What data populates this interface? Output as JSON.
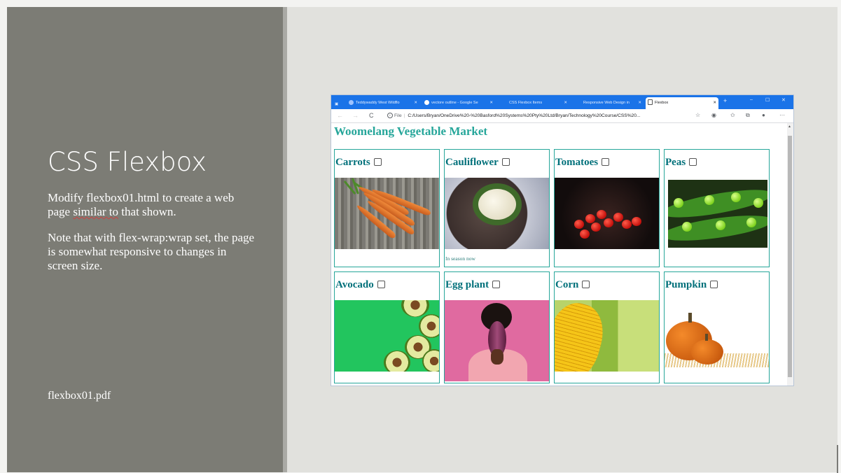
{
  "slide": {
    "title": "CSS Flexbox",
    "paragraph1_before": "Modify flexbox01.html to create a web page ",
    "paragraph1_squiggle": "similar to",
    "paragraph1_after": " that shown.",
    "paragraph2": "Note that with flex-wrap:wrap set, the page is somewhat responsive to changes in screen size.",
    "footer_file": "flexbox01.pdf"
  },
  "browser": {
    "tabs": [
      {
        "label": "Teddywaddy West Wildflo"
      },
      {
        "label": "vectore outline - Google Se"
      },
      {
        "label": "CSS Flexbox Items"
      },
      {
        "label": "Responsive Web Design in"
      },
      {
        "label": "Flexbox",
        "active": true
      }
    ],
    "new_tab": "+",
    "win_minimize": "–",
    "win_maximize": "☐",
    "win_close": "✕",
    "nav_back": "←",
    "nav_forward": "→",
    "nav_reload": "C",
    "address_prefix": "File",
    "address_url": "C:/Users/Bryan/OneDrive%20-%20Basford%20Systems%20Pty%20Ltd/Bryan/Technology%20Course/CSS%20...",
    "toolbar_icons": [
      "read-aloud-icon",
      "shield-icon",
      "favorites-icon",
      "collections-icon",
      "profile-icon",
      "more-icon"
    ],
    "more_label": "···"
  },
  "page": {
    "heading": "Woomelang Vegetable Market",
    "cards": [
      {
        "name": "Carrots",
        "caption": ""
      },
      {
        "name": "Cauliflower",
        "caption": "In season now"
      },
      {
        "name": "Tomatoes",
        "caption": ""
      },
      {
        "name": "Peas",
        "caption": ""
      },
      {
        "name": "Avocado",
        "caption": ""
      },
      {
        "name": "Egg plant",
        "caption": ""
      },
      {
        "name": "Corn",
        "caption": ""
      },
      {
        "name": "Pumpkin",
        "caption": ""
      }
    ]
  },
  "colors": {
    "slide_left_panel": "#7c7c75",
    "slide_background": "#e1e1dd",
    "browser_chrome": "#1a73e8",
    "accent_teal": "#26a69a"
  }
}
